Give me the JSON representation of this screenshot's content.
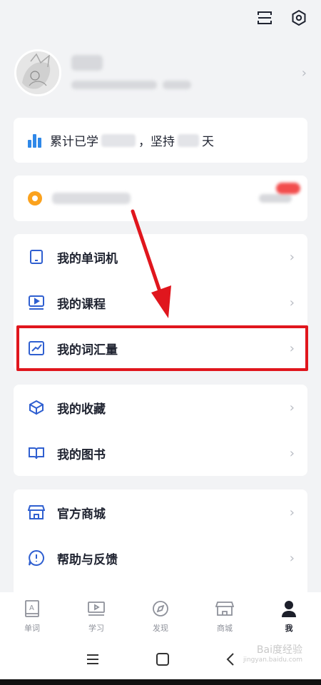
{
  "stats": {
    "prefix": "累计已学",
    "middle": "，坚持",
    "suffix": "天",
    "bar_color": "#2f88e8"
  },
  "menu_group_1": [
    {
      "label": "我的单词机",
      "icon": "device-icon"
    },
    {
      "label": "我的课程",
      "icon": "course-icon"
    },
    {
      "label": "我的词汇量",
      "icon": "vocab-chart-icon",
      "highlighted": true
    }
  ],
  "menu_group_2": [
    {
      "label": "我的收藏",
      "icon": "box-icon"
    },
    {
      "label": "我的图书",
      "icon": "book-icon"
    }
  ],
  "menu_group_3": [
    {
      "label": "官方商城",
      "icon": "store-icon"
    },
    {
      "label": "帮助与反馈",
      "icon": "help-icon"
    }
  ],
  "tabs": [
    {
      "label": "单词",
      "icon": "word-icon"
    },
    {
      "label": "学习",
      "icon": "study-icon"
    },
    {
      "label": "发现",
      "icon": "compass-icon"
    },
    {
      "label": "商城",
      "icon": "shop-icon"
    },
    {
      "label": "我",
      "icon": "person-icon",
      "active": true
    }
  ],
  "watermark": {
    "brand": "Bai度经验",
    "url": "jingyan.baidu.com"
  },
  "colors": {
    "highlight": "#e0161d",
    "accent_blue": "#2f5fd0",
    "coin": "#fba21d"
  }
}
